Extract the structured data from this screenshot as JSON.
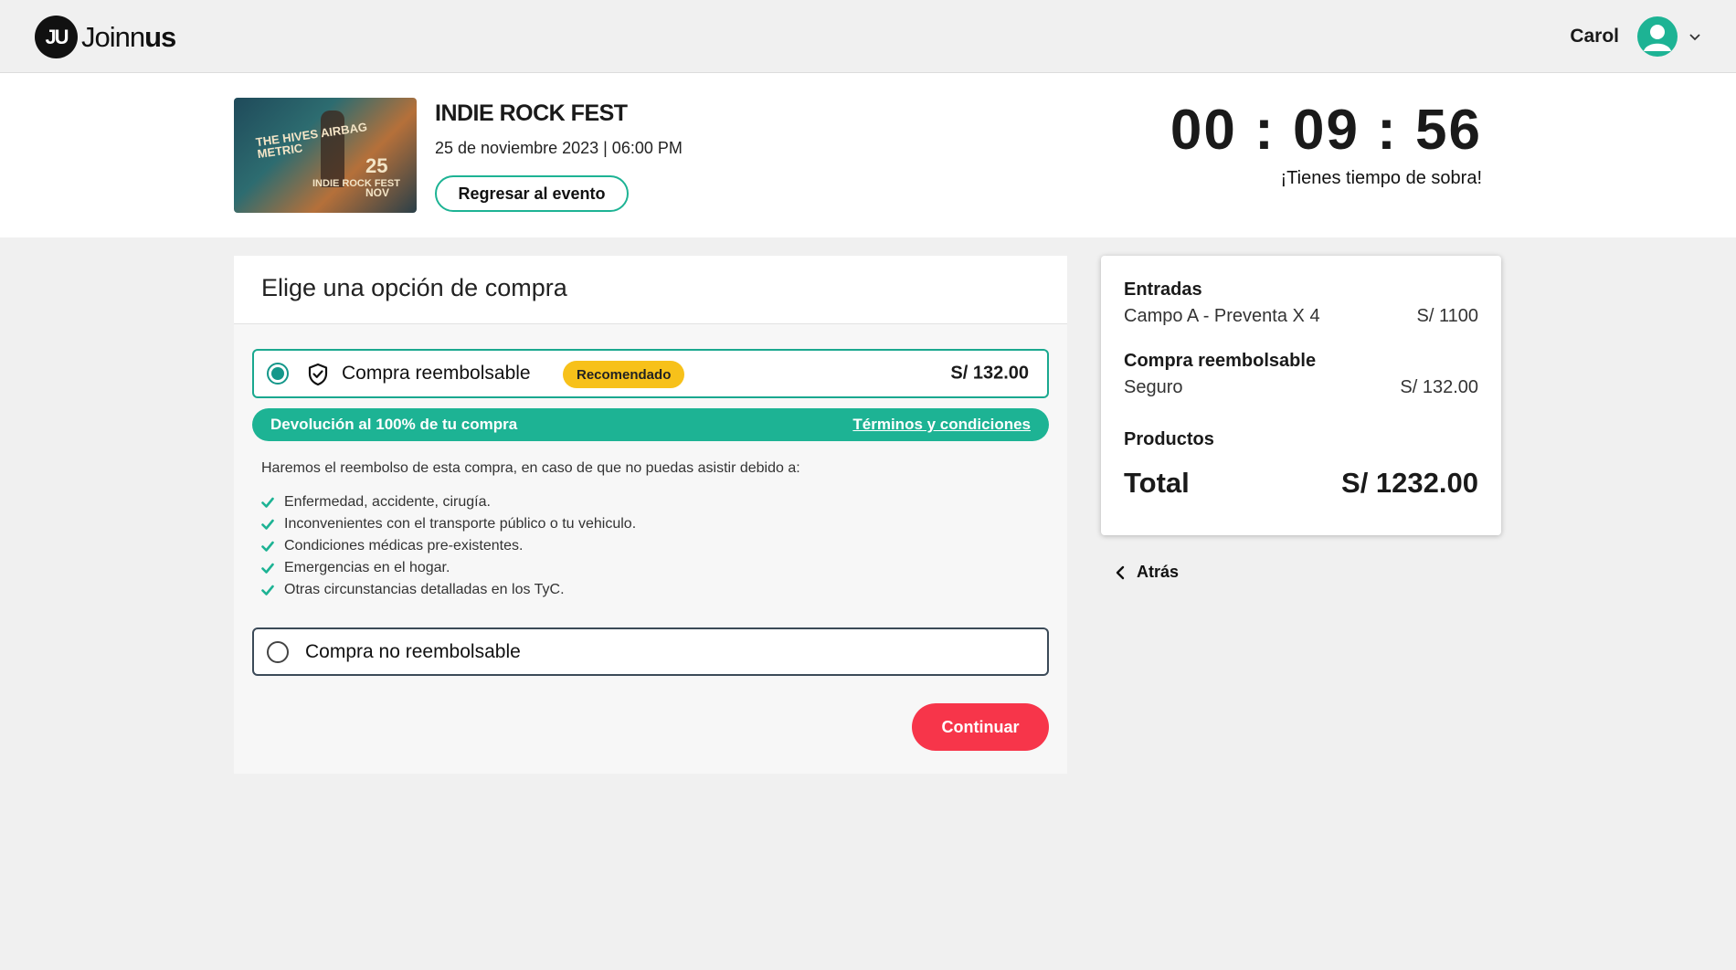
{
  "brand": {
    "logo_mark": "JU",
    "logo_text_light": "Joinn",
    "logo_text_bold": "us"
  },
  "user": {
    "name": "Carol",
    "avatar_icon": "user-avatar-icon",
    "menu_icon": "chevron-down-icon"
  },
  "event": {
    "title": "INDIE ROCK FEST",
    "date": "25 de noviembre 2023 | 06:00 PM",
    "back_button": "Regresar al evento",
    "poster": {
      "headline": "THE HIVES AIRBAG METRIC",
      "day": "25",
      "month": "NOV",
      "subtitle": "INDIE ROCK FEST"
    }
  },
  "timer": {
    "display": "00 : 09 : 56",
    "message": "¡Tienes tiempo de sobra!"
  },
  "purchase": {
    "title": "Elige una opción de compra",
    "refundable": {
      "label": "Compra reembolsable",
      "badge": "Recomendado",
      "price": "S/ 132.00",
      "selected": true,
      "banner_left": "Devolución al 100% de tu compra",
      "banner_link": "Términos y condiciones",
      "description": "Haremos el reembolso de esta compra, en caso de que no puedas asistir debido a:",
      "reasons": [
        "Enfermedad, accidente, cirugía.",
        "Inconvenientes con el transporte público o tu vehiculo.",
        "Condiciones médicas pre-existentes.",
        "Emergencias en el hogar.",
        "Otras circunstancias detalladas en los TyC."
      ]
    },
    "non_refundable": {
      "label": "Compra no reembolsable",
      "selected": false
    },
    "continue_button": "Continuar"
  },
  "summary": {
    "tickets_heading": "Entradas",
    "ticket_line": "Campo A - Preventa X 4",
    "ticket_price": "S/ 1100",
    "refund_heading": "Compra reembolsable",
    "insurance_line": "Seguro",
    "insurance_price": "S/ 132.00",
    "products_heading": "Productos",
    "total_label": "Total",
    "total_value": "S/ 1232.00"
  },
  "back_link": "Atrás",
  "colors": {
    "accent": "#1db394",
    "radio": "#14978a",
    "badge": "#f7c11a",
    "cta": "#f7354a"
  }
}
